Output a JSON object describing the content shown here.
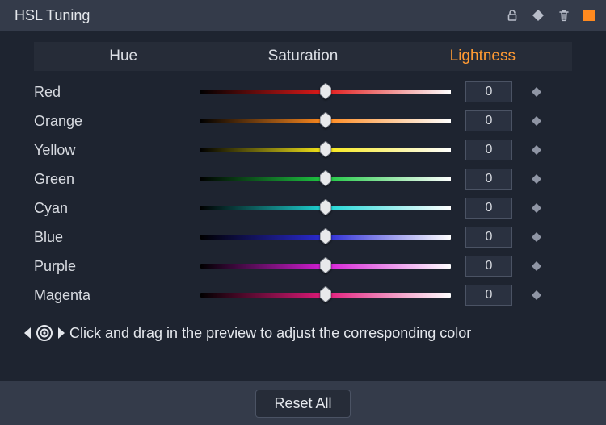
{
  "title": "HSL Tuning",
  "tabs": {
    "hue": "Hue",
    "saturation": "Saturation",
    "lightness": "Lightness",
    "active": "lightness"
  },
  "rows": [
    {
      "label": "Red",
      "value": "0"
    },
    {
      "label": "Orange",
      "value": "0"
    },
    {
      "label": "Yellow",
      "value": "0"
    },
    {
      "label": "Green",
      "value": "0"
    },
    {
      "label": "Cyan",
      "value": "0"
    },
    {
      "label": "Blue",
      "value": "0"
    },
    {
      "label": "Purple",
      "value": "0"
    },
    {
      "label": "Magenta",
      "value": "0"
    }
  ],
  "hint": "Click and drag in the preview to adjust the corresponding color",
  "reset_label": "Reset All"
}
